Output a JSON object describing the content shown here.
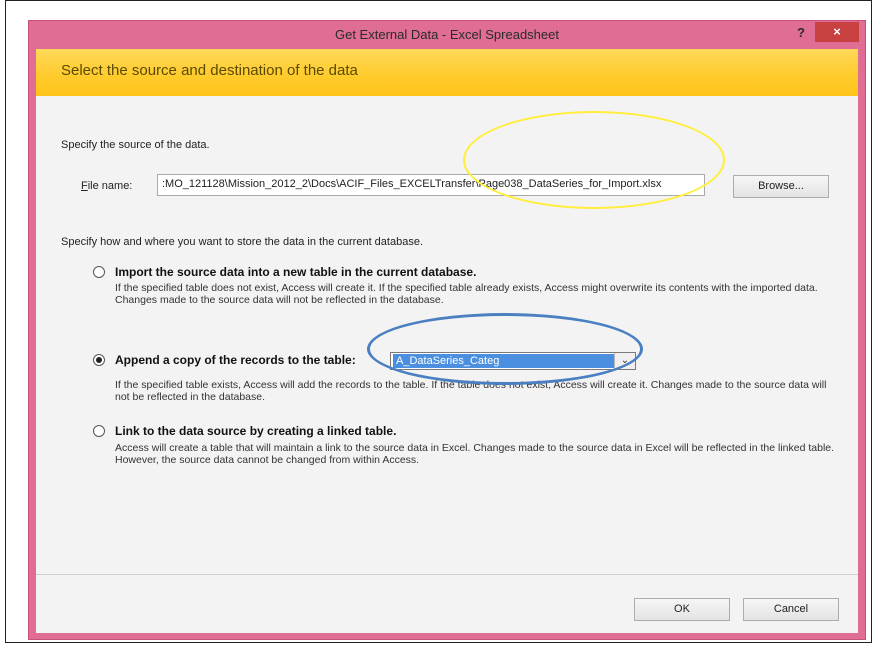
{
  "window": {
    "title": "Get External Data - Excel Spreadsheet",
    "help": "?",
    "close": "×"
  },
  "header": {
    "text": "Select the source and destination of the data"
  },
  "source": {
    "prompt": "Specify the source of the data.",
    "file_label": "File name:",
    "file_value": ":MO_121128\\Mission_2012_2\\Docs\\ACIF_Files_EXCELTransfer\\Page038_DataSeries_for_Import.xlsx",
    "browse": "Browse..."
  },
  "storage": {
    "prompt": "Specify how and where you want to store the data in the current database."
  },
  "options": [
    {
      "title": "Import the source data into a new table in the current database.",
      "desc": "If the specified table does not exist, Access will create it. If the specified table already exists, Access might overwrite its contents with the imported data. Changes made to the source data will not be reflected in the database.",
      "selected": false
    },
    {
      "title": "Append a copy of the records to the table:",
      "desc": "If the specified table exists, Access will add the records to the table. If the table does not exist, Access will create it. Changes made to the source data will not be reflected in the database.",
      "selected": true,
      "table_value": "A_DataSeries_Categ"
    },
    {
      "title": "Link to the data source by creating a linked table.",
      "desc": "Access will create a table that will maintain a link to the source data in Excel. Changes made to the source data in Excel will be reflected in the linked table. However, the source data cannot be changed from within Access.",
      "selected": false
    }
  ],
  "footer": {
    "ok": "OK",
    "cancel": "Cancel"
  },
  "colors": {
    "title_bar": "#e06d93",
    "header_band": "#ffcc2e",
    "close_button": "#c8403f",
    "selection": "#4a8fe0",
    "annotation_yellow": "#ffee3a",
    "annotation_blue": "#4a7fc1"
  }
}
